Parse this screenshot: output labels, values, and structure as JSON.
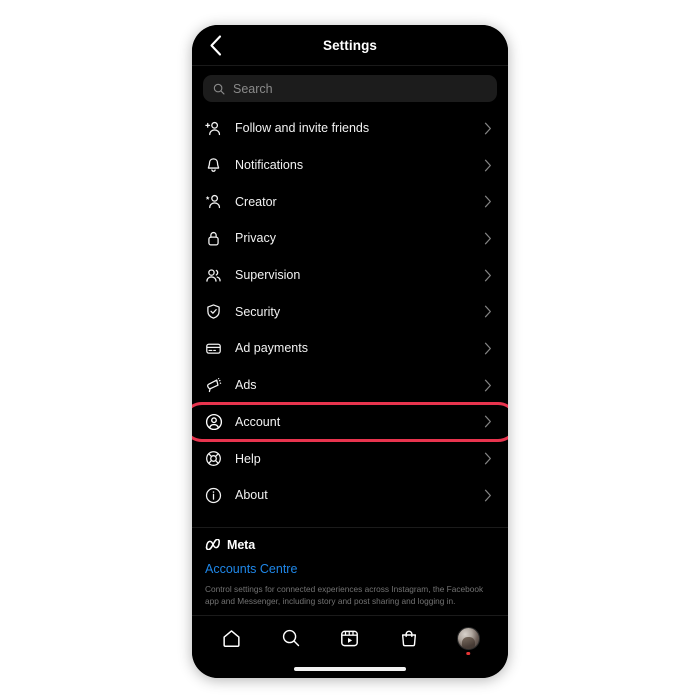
{
  "header": {
    "title": "Settings",
    "back_icon": "chevron-left-icon"
  },
  "search": {
    "placeholder": "Search",
    "value": "",
    "icon": "search-icon"
  },
  "menu": {
    "items": [
      {
        "label": "Follow and invite friends",
        "icon": "person-add-icon",
        "chevron": "chevron-right-icon",
        "highlighted": false
      },
      {
        "label": "Notifications",
        "icon": "bell-icon",
        "chevron": "chevron-right-icon",
        "highlighted": false
      },
      {
        "label": "Creator",
        "icon": "person-star-icon",
        "chevron": "chevron-right-icon",
        "highlighted": false
      },
      {
        "label": "Privacy",
        "icon": "lock-icon",
        "chevron": "chevron-right-icon",
        "highlighted": false
      },
      {
        "label": "Supervision",
        "icon": "people-icon",
        "chevron": "chevron-right-icon",
        "highlighted": false
      },
      {
        "label": "Security",
        "icon": "shield-check-icon",
        "chevron": "chevron-right-icon",
        "highlighted": false
      },
      {
        "label": "Ad payments",
        "icon": "credit-card-icon",
        "chevron": "chevron-right-icon",
        "highlighted": false
      },
      {
        "label": "Ads",
        "icon": "megaphone-icon",
        "chevron": "chevron-right-icon",
        "highlighted": false
      },
      {
        "label": "Account",
        "icon": "person-circle-icon",
        "chevron": "chevron-right-icon",
        "highlighted": true
      },
      {
        "label": "Help",
        "icon": "lifebuoy-icon",
        "chevron": "chevron-right-icon",
        "highlighted": false
      },
      {
        "label": "About",
        "icon": "info-circle-icon",
        "chevron": "chevron-right-icon",
        "highlighted": false
      }
    ]
  },
  "meta_section": {
    "brand": "Meta",
    "brand_icon": "meta-infinity-icon",
    "link": "Accounts Centre",
    "description": "Control settings for connected experiences across Instagram, the Facebook app and Messenger, including story and post sharing and logging in."
  },
  "tabbar": {
    "items": [
      {
        "name": "home",
        "icon": "home-icon"
      },
      {
        "name": "search",
        "icon": "search-icon"
      },
      {
        "name": "reels",
        "icon": "reels-icon"
      },
      {
        "name": "shop",
        "icon": "shop-bag-icon"
      },
      {
        "name": "profile",
        "icon": "profile-avatar",
        "badge": true
      }
    ]
  },
  "colors": {
    "highlight": "#e8344e",
    "link": "#1f87e8",
    "background": "#000000",
    "search_field": "#1c1c1c",
    "badge": "#e63535"
  }
}
